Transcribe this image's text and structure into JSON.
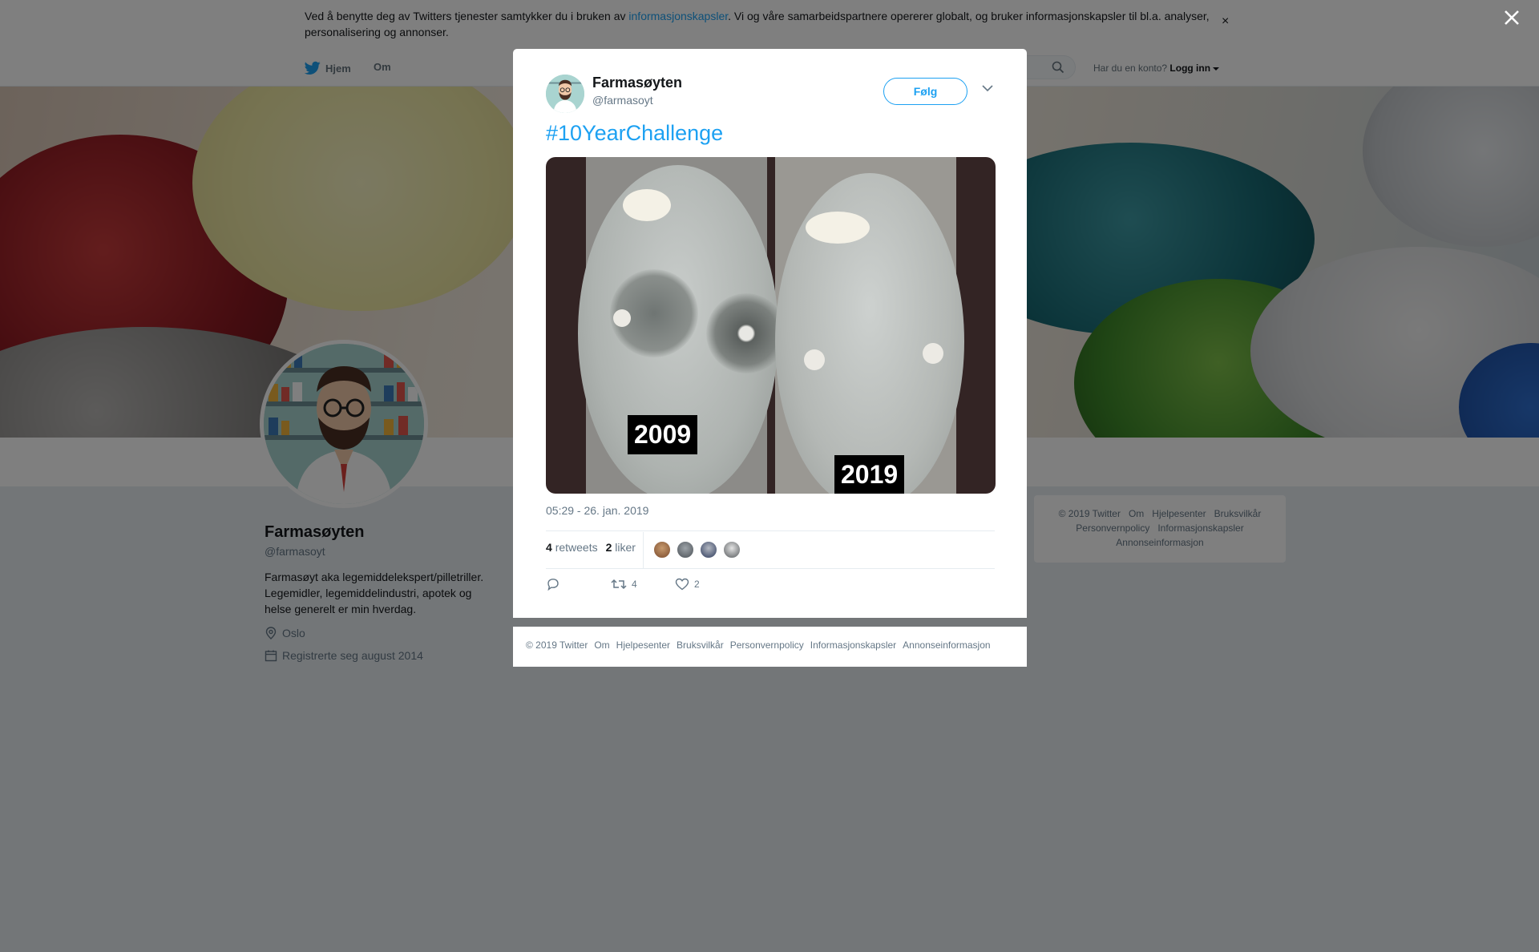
{
  "cookie_banner": {
    "text_before": "Ved å benytte deg av Twitters tjenester samtykker du i bruken av ",
    "link": "informasjonskapsler",
    "text_after": ". Vi og våre samarbeidspartnere opererer globalt, og bruker informasjonskapsler til bl.a. analyser, personalisering og annonser.",
    "close_glyph": "×"
  },
  "nav": {
    "home": "Hjem",
    "about": "Om",
    "login_prompt": "Har du en konto?",
    "login": "Logg inn"
  },
  "profile": {
    "name": "Farmasøyten",
    "handle": "@farmasoyt",
    "bio": "Farmasøyt aka legemiddelekspert/pilletriller. Legemidler, legemiddelindustri, apotek og helse generelt er min hverdag.",
    "location": "Oslo",
    "joined": "Registrerte seg august 2014"
  },
  "right_footer": {
    "links": [
      "© 2019 Twitter",
      "Om",
      "Hjelpesenter",
      "Bruksvilkår",
      "Personvernpolicy",
      "Informasjonskapsler",
      "Annonseinformasjon"
    ]
  },
  "tweet": {
    "author_name": "Farmasøyten",
    "author_handle": "@farmasoyt",
    "follow_label": "Følg",
    "text": "#10YearChallenge",
    "photo_labels": [
      "2009",
      "2019"
    ],
    "timestamp": "05:29 - 26. jan. 2019",
    "retweets_count": "4",
    "retweets_label": "retweets",
    "likes_count": "2",
    "likes_label": "liker",
    "action_retweet_count": "4",
    "action_like_count": "2"
  },
  "modal_footer": {
    "links": [
      "© 2019 Twitter",
      "Om",
      "Hjelpesenter",
      "Bruksvilkår",
      "Personvernpolicy",
      "Informasjonskapsler",
      "Annonseinformasjon"
    ]
  },
  "colors": {
    "accent": "#1da1f2",
    "overlay": "rgba(0,0,0,0.5)",
    "background": "#e6ecf0"
  },
  "icons": [
    "twitter-bird-icon",
    "search-icon",
    "caret-down-icon",
    "close-icon",
    "location-icon",
    "calendar-icon",
    "reply-icon",
    "retweet-icon",
    "heart-icon",
    "chevron-down-icon"
  ]
}
